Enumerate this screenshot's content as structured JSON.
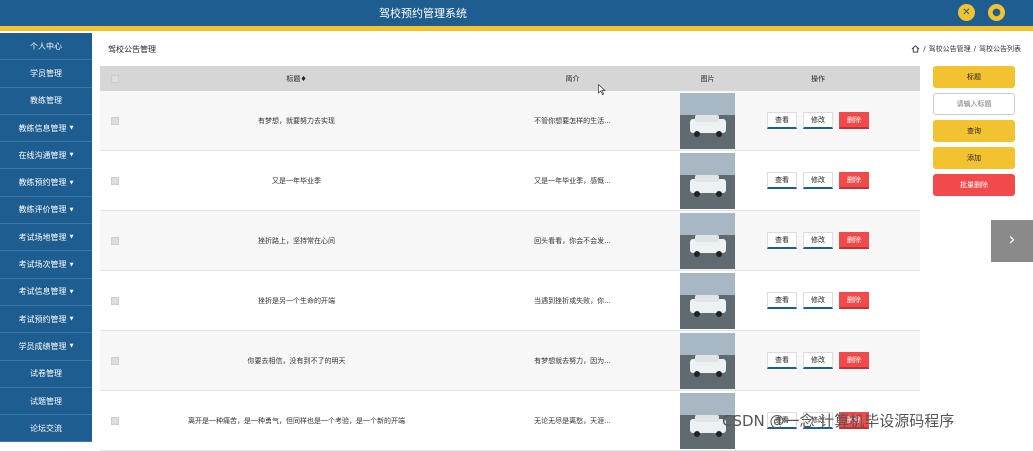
{
  "header": {
    "title": "驾校预约管理系统",
    "icons": [
      "fullscreen-icon",
      "user-icon"
    ]
  },
  "sidebar": {
    "items": [
      {
        "label": "个人中心",
        "has_caret": false
      },
      {
        "label": "学员管理",
        "has_caret": false
      },
      {
        "label": "教练管理",
        "has_caret": false
      },
      {
        "label": "教练信息管理",
        "has_caret": true
      },
      {
        "label": "在线沟通管理",
        "has_caret": true
      },
      {
        "label": "教练预约管理",
        "has_caret": true
      },
      {
        "label": "教练评价管理",
        "has_caret": true
      },
      {
        "label": "考试场地管理",
        "has_caret": true
      },
      {
        "label": "考试场次管理",
        "has_caret": true
      },
      {
        "label": "考试信息管理",
        "has_caret": true
      },
      {
        "label": "考试预约管理",
        "has_caret": true
      },
      {
        "label": "学员成绩管理",
        "has_caret": true
      },
      {
        "label": "试卷管理",
        "has_caret": false
      },
      {
        "label": "试题管理",
        "has_caret": false
      },
      {
        "label": "论坛交流",
        "has_caret": false
      }
    ]
  },
  "page": {
    "heading": "驾校公告管理",
    "breadcrumb": [
      "驾校公告管理",
      "驾校公告列表"
    ],
    "breadcrumb_sep": "/"
  },
  "table": {
    "columns": [
      "标题♦",
      "简介",
      "图片",
      "操作"
    ],
    "ops": {
      "view": "查看",
      "edit": "修改",
      "delete": "删除"
    },
    "rows": [
      {
        "title": "有梦想，就要努力去实现",
        "intro": "不管你想要怎样的生活..."
      },
      {
        "title": "又是一年毕业季",
        "intro": "又是一年毕业季，感慨..."
      },
      {
        "title": "挫折路上，坚持常在心间",
        "intro": "回头看看，你会不会发..."
      },
      {
        "title": "挫折是另一个生命的开端",
        "intro": "当遇到挫折或失败，你..."
      },
      {
        "title": "你要去相信，没有到不了的明天",
        "intro": "有梦想就去努力，因为..."
      },
      {
        "title": "离开是一种痛苦，是一种勇气，但同样也是一个考验，是一个新的开端",
        "intro": "无论无尽是离愁，天涯..."
      }
    ]
  },
  "rail": {
    "title_button": "标题",
    "search_placeholder": "请输入标题",
    "query": "查询",
    "add": "添加",
    "batch_delete": "批量删除"
  },
  "next_arrow": "›",
  "watermark": "CSDN @一念 计算机毕设源码程序",
  "colors": {
    "primary": "#1e5d90",
    "accent": "#f2c230",
    "danger": "#f24a4a"
  }
}
